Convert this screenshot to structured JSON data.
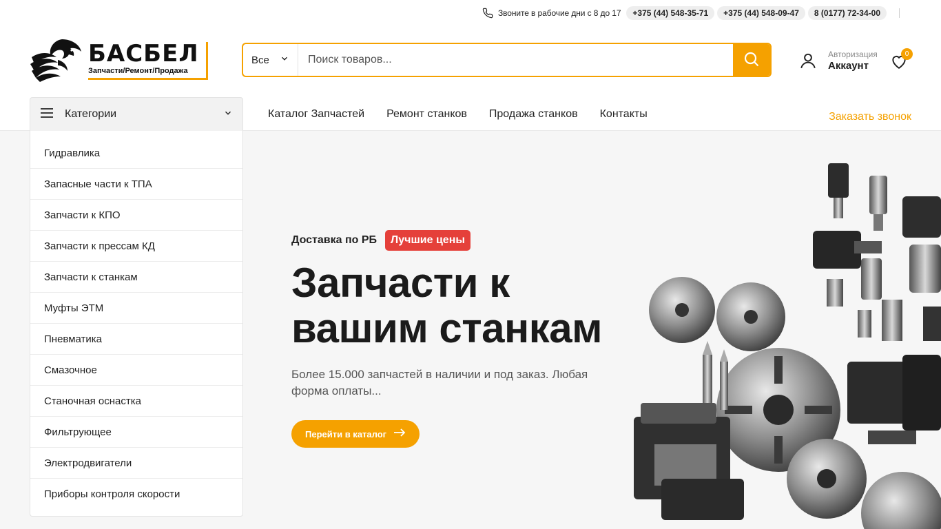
{
  "topbar": {
    "hours": "Звоните в рабочие дни с 8 до 17",
    "phones": [
      "+375 (44) 548-35-71",
      "+375 (44) 548-09-47",
      "8 (0177) 72-34-00"
    ]
  },
  "logo": {
    "title": "БАСБЕЛ",
    "subtitle": "Запчасти/Ремонт/Продажа"
  },
  "search": {
    "category": "Все",
    "placeholder": "Поиск товаров..."
  },
  "account": {
    "label_small": "Авторизация",
    "label_big": "Аккаунт"
  },
  "wishlist": {
    "count": "0"
  },
  "nav": {
    "categories_label": "Категории",
    "links": [
      "Каталог Запчастей",
      "Ремонт станков",
      "Продажа станков",
      "Контакты"
    ],
    "callback": "Заказать звонок"
  },
  "sidebar": {
    "items": [
      "Гидравлика",
      "Запасные части к ТПА",
      "Запчасти к КПО",
      "Запчасти к прессам КД",
      "Запчасти к станкам",
      "Муфты ЭТМ",
      "Пневматика",
      "Смазочное",
      "Станочная оснастка",
      "Фильтрующее",
      "Электродвигатели",
      "Приборы контроля скорости"
    ]
  },
  "hero": {
    "tag": "Доставка по РБ",
    "badge": "Лучшие цены",
    "title": "Запчасти к вашим станкам",
    "description": "Более 15.000 запчастей в наличии и под заказ. Любая форма оплаты...",
    "button": "Перейти в каталог"
  },
  "colors": {
    "accent": "#f5a100",
    "badge": "#e5403a",
    "hero_bg": "#f6f6f6"
  }
}
